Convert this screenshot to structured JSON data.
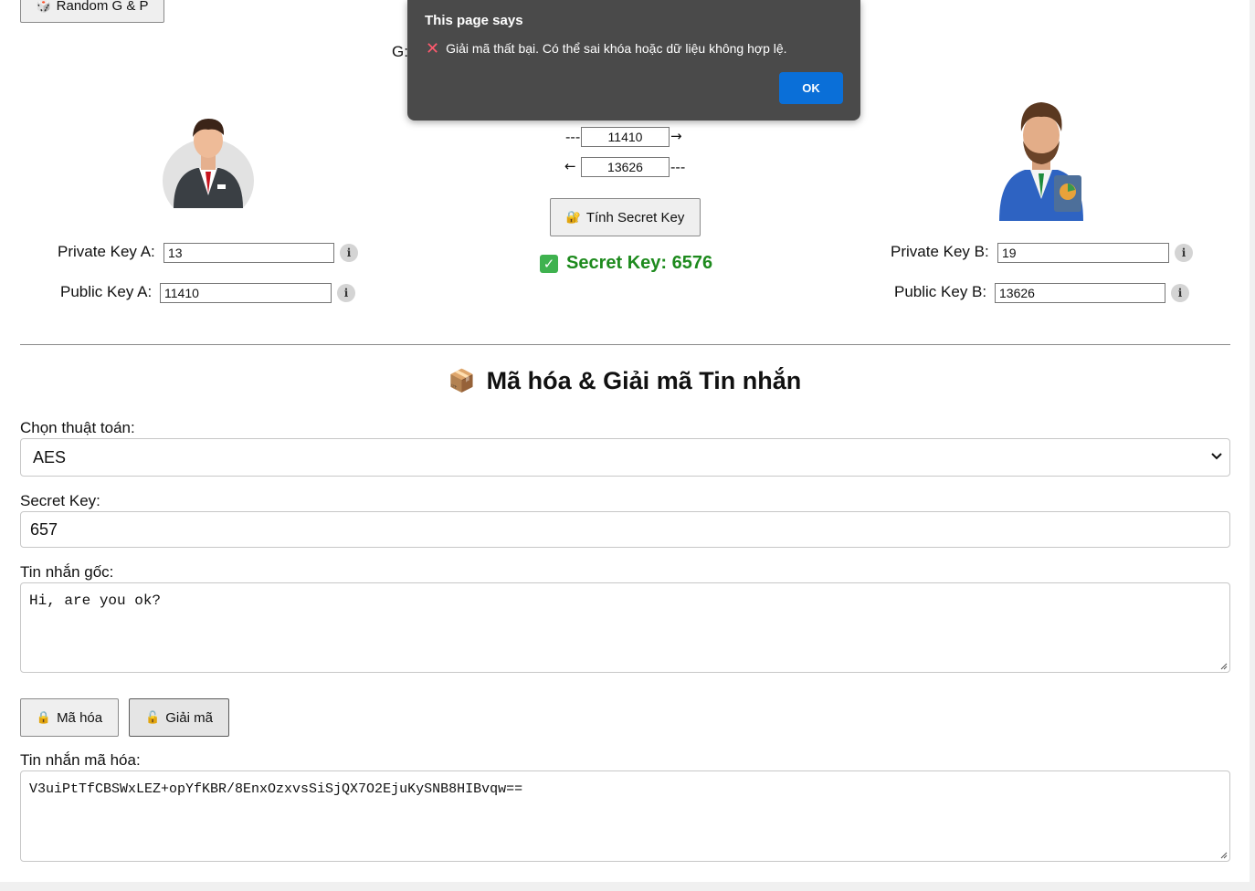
{
  "top": {
    "random_button": "Random G & P",
    "g_label": "G:"
  },
  "dialog": {
    "title": "This page says",
    "message": "Giải mã thất bại. Có thể sai khóa hoặc dữ liệu không hợp lệ.",
    "ok": "OK"
  },
  "exchange": {
    "a_to_b_value": "11410",
    "b_to_a_value": "13626",
    "arrow_right_prefix": "---",
    "arrow_right": "→",
    "arrow_left": "←",
    "arrow_left_suffix": "---",
    "compute_button": "Tính Secret Key",
    "secret_result": "Secret Key: 6576"
  },
  "alice": {
    "private_label": "Private Key A:",
    "private_value": "13",
    "public_label": "Public Key A:",
    "public_value": "11410"
  },
  "bob": {
    "private_label": "Private Key B:",
    "private_value": "19",
    "public_label": "Public Key B:",
    "public_value": "13626"
  },
  "info_glyph": "i",
  "section": {
    "title": "Mã hóa & Giải mã Tin nhắn",
    "algo_label": "Chọn thuật toán:",
    "algo_value": "AES",
    "secret_label": "Secret Key:",
    "secret_value": "657",
    "plain_label": "Tin nhắn gốc:",
    "plain_value": "Hi, are you ok?",
    "encrypt_button": "Mã hóa",
    "decrypt_button": "Giải mã",
    "cipher_label": "Tin nhắn mã hóa:",
    "cipher_value": "V3uiPtTfCBSWxLEZ+opYfKBR/8EnxOzxvsSiSjQX7O2EjuKySNB8HIBvqw=="
  },
  "icons": {
    "dice": "dice-icon",
    "lock_open": "unlock-icon",
    "check": "check-icon",
    "box": "box-icon",
    "lock": "lock-icon"
  }
}
